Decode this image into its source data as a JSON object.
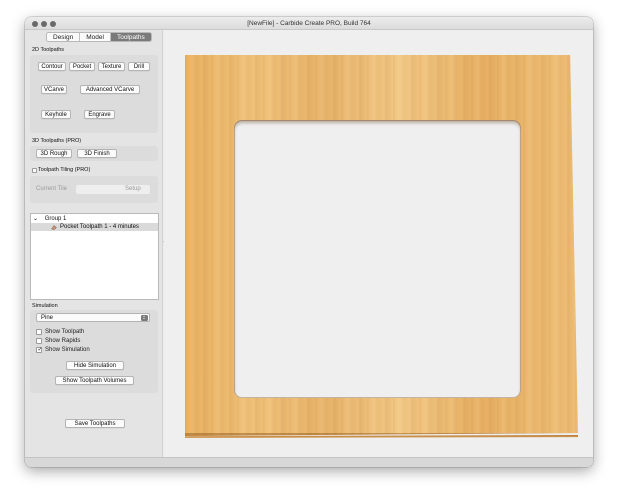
{
  "window": {
    "title": "[NewFile] - Carbide Create PRO, Build 764"
  },
  "tabs": [
    {
      "label": "Design",
      "active": false
    },
    {
      "label": "Model",
      "active": false
    },
    {
      "label": "Toolpaths",
      "active": true
    }
  ],
  "toolpaths_2d": {
    "label": "2D Toolpaths",
    "buttons": [
      "Contour",
      "Pocket",
      "Texture",
      "Drill",
      "VCarve",
      "Advanced VCarve",
      "Keyhole",
      "Engrave"
    ]
  },
  "toolpaths_3d": {
    "label": "3D Toolpaths (PRO)",
    "buttons": [
      "3D Rough",
      "3D Finish"
    ]
  },
  "tiling": {
    "label": "Toolpath Tiling (PRO)",
    "checked": false,
    "current_tile_label": "Current Tile",
    "setup_label": "Setup"
  },
  "toolpath_list": {
    "group_name": "Group 1",
    "items": [
      "Pocket Toolpath 1 - 4 minutes"
    ]
  },
  "simulation": {
    "label": "Simulation",
    "material": "Pine",
    "show_toolpath": {
      "label": "Show Toolpath",
      "checked": false
    },
    "show_rapids": {
      "label": "Show Rapids",
      "checked": false
    },
    "show_simulation": {
      "label": "Show Simulation",
      "checked": true
    },
    "hide_button": "Hide Simulation",
    "volumes_button": "Show Toolpath Volumes"
  },
  "save_button": "Save Toolpaths",
  "colors": {
    "wood": "#eebc72",
    "active_tab": "#7a7a7a",
    "canvas_bg": "#efefef"
  }
}
